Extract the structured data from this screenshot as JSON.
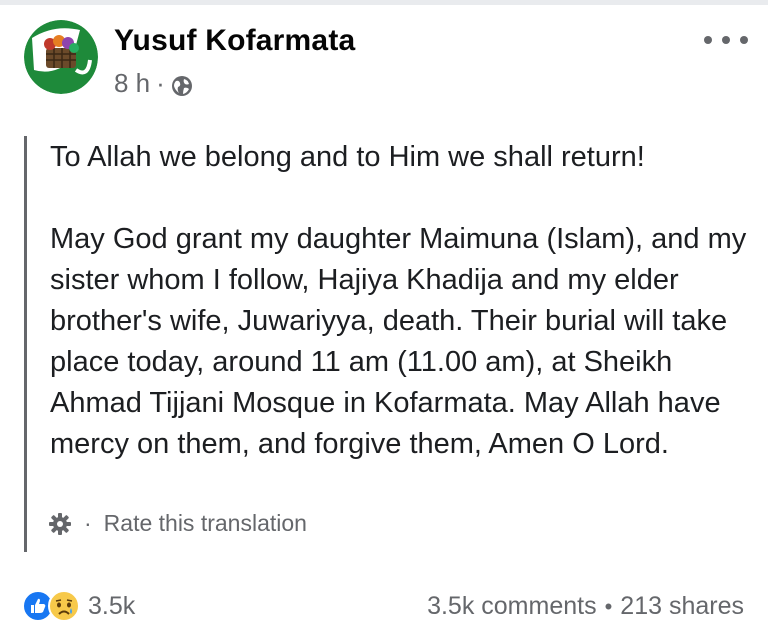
{
  "post": {
    "author": "Yusuf Kofarmata",
    "time": "8 h",
    "separator": "·",
    "audience_icon": "globe-icon",
    "more_icon": "more-options-icon",
    "text": {
      "paragraph1": "To Allah we belong and to Him we shall return!",
      "paragraph2": "May God grant my daughter Maimuna (Islam), and my sister whom I follow, Hajiya Khadija and my elder brother's wife, Juwariyya, death. Their burial will take place today, around 11 am (11.00 am), at Sheikh Ahmad Tijjani Mosque in Kofarmata. May Allah have mercy on them, and forgive them, Amen O Lord."
    },
    "translation": {
      "icon": "gear-icon",
      "separator": "·",
      "label": "Rate this translation"
    }
  },
  "footer": {
    "reaction_icons": [
      "like-icon",
      "sad-icon"
    ],
    "reaction_count": "3.5k",
    "comments": "3.5k comments",
    "separator": "•",
    "shares": "213 shares"
  },
  "colors": {
    "secondary_text": "#65676b",
    "like_blue": "#1877f2",
    "sad_yellow": "#f7c94a"
  }
}
